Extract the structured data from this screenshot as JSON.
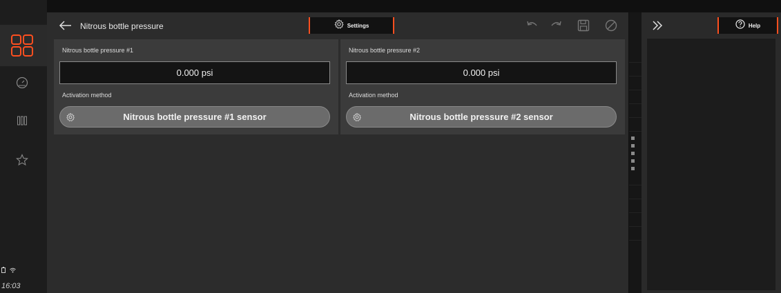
{
  "header": {
    "title": "Nitrous bottle pressure",
    "settings_label": "Settings"
  },
  "panels": [
    {
      "name": "Nitrous bottle pressure #1",
      "value": "0.000 psi",
      "activation_label": "Activation method",
      "sensor_label": "Nitrous bottle pressure #1 sensor"
    },
    {
      "name": "Nitrous bottle pressure #2",
      "value": "0.000 psi",
      "activation_label": "Activation method",
      "sensor_label": "Nitrous bottle pressure #2 sensor"
    }
  ],
  "help": {
    "label": "Help"
  },
  "status": {
    "time": "16:03"
  },
  "icons": {
    "rail": [
      "dashboard-grid-icon",
      "gauge-icon",
      "columns-icon",
      "star-icon"
    ],
    "toolbar": [
      "undo-icon",
      "redo-icon",
      "save-icon",
      "cancel-icon"
    ]
  },
  "colors": {
    "accent": "#ff4f1f"
  }
}
